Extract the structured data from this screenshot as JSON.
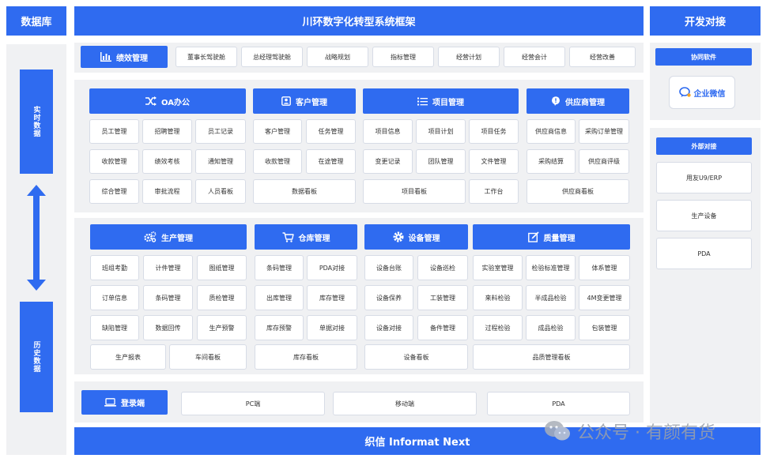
{
  "left": {
    "title": "数据库",
    "realtime": "实时数据",
    "history": "历史数据"
  },
  "header": {
    "title": "川环数字化转型系统框架"
  },
  "right": {
    "title": "开发对接",
    "collab_label": "协同软件",
    "wecom_label": "企业微信",
    "external_label": "外部对接",
    "external_items": [
      "用友U9/ERP",
      "生产设备",
      "PDA"
    ]
  },
  "performance": {
    "label": "绩效管理",
    "items": [
      "董事长驾驶舱",
      "总经理驾驶舱",
      "战略规划",
      "指标管理",
      "经营计划",
      "经营会计",
      "经营改善"
    ]
  },
  "oa": {
    "label": "OA办公",
    "items": [
      "员工管理",
      "招聘管理",
      "员工记录",
      "收款管理",
      "绩效考核",
      "通知管理",
      "综合管理",
      "审批流程",
      "人员看板"
    ]
  },
  "customer": {
    "label": "客户管理",
    "items": [
      "客户管理",
      "任务管理",
      "收款管理",
      "在途管理",
      "数据看板"
    ]
  },
  "project": {
    "label": "项目管理",
    "items": [
      "项目信息",
      "项目计划",
      "项目任务",
      "变更记录",
      "团队管理",
      "文件管理",
      "项目看板",
      "工作台"
    ]
  },
  "supplier": {
    "label": "供应商管理",
    "items": [
      "供应商信息",
      "采购订单管理",
      "采购结算",
      "供应商评级",
      "供应商看板"
    ]
  },
  "production": {
    "label": "生产管理",
    "items": [
      "班组考勤",
      "计件管理",
      "图纸管理",
      "订单信息",
      "条码管理",
      "质检管理",
      "缺陷管理",
      "数据回传",
      "生产预警",
      "生产报表",
      "车间看板"
    ]
  },
  "warehouse": {
    "label": "仓库管理",
    "items": [
      "条码管理",
      "PDA对接",
      "出库管理",
      "库存管理",
      "库存预警",
      "单据对接",
      "库存看板"
    ]
  },
  "equipment": {
    "label": "设备管理",
    "items": [
      "设备台账",
      "设备巡检",
      "设备保养",
      "工装管理",
      "设备对接",
      "备件管理",
      "设备看板"
    ]
  },
  "quality": {
    "label": "质量管理",
    "items": [
      "实验室管理",
      "检验标准管理",
      "体系管理",
      "来料检验",
      "半成品检验",
      "4M变更管理",
      "过程检验",
      "成品检验",
      "包装管理",
      "品质管理看板"
    ]
  },
  "login": {
    "label": "登录端",
    "items": [
      "PC端",
      "移动端",
      "PDA"
    ]
  },
  "footer": {
    "title": "织信 Informat Next"
  },
  "watermark": {
    "text": "公众号 · 有颜有货"
  },
  "colors": {
    "primary": "#2f6bf0",
    "panel": "#f0f1f3",
    "cell_border": "#d7dce6"
  }
}
